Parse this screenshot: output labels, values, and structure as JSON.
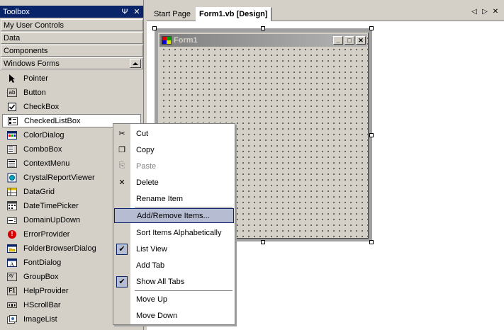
{
  "toolbox": {
    "title": "Toolbox",
    "pin_glyph": "Ψ",
    "close_glyph": "✕",
    "tabs": [
      "My User Controls",
      "Data",
      "Components",
      "Windows Forms"
    ],
    "items": [
      {
        "label": "Pointer",
        "icon": "pointer-icon"
      },
      {
        "label": "Button",
        "icon": "button-icon"
      },
      {
        "label": "CheckBox",
        "icon": "checkbox-icon"
      },
      {
        "label": "CheckedListBox",
        "icon": "checkedlistbox-icon"
      },
      {
        "label": "ColorDialog",
        "icon": "colordialog-icon"
      },
      {
        "label": "ComboBox",
        "icon": "combobox-icon"
      },
      {
        "label": "ContextMenu",
        "icon": "contextmenu-icon"
      },
      {
        "label": "CrystalReportViewer",
        "icon": "crystalreportviewer-icon"
      },
      {
        "label": "DataGrid",
        "icon": "datagrid-icon"
      },
      {
        "label": "DateTimePicker",
        "icon": "datetimepicker-icon"
      },
      {
        "label": "DomainUpDown",
        "icon": "domainupdown-icon"
      },
      {
        "label": "ErrorProvider",
        "icon": "errorprovider-icon"
      },
      {
        "label": "FolderBrowserDialog",
        "icon": "folderbrowserdialog-icon"
      },
      {
        "label": "FontDialog",
        "icon": "fontdialog-icon"
      },
      {
        "label": "GroupBox",
        "icon": "groupbox-icon"
      },
      {
        "label": "HelpProvider",
        "icon": "helpprovider-icon"
      },
      {
        "label": "HScrollBar",
        "icon": "hscrollbar-icon"
      },
      {
        "label": "ImageList",
        "icon": "imagelist-icon"
      }
    ],
    "icon_text": {
      "button": "ab",
      "helpprovider": "F1",
      "groupbox": "xy",
      "error": "!"
    }
  },
  "document": {
    "tabs": [
      "Start Page",
      "Form1.vb [Design]"
    ],
    "nav_left": "◁",
    "nav_right": "▷",
    "nav_close": "✕"
  },
  "form": {
    "title": "Form1",
    "min_glyph": "_",
    "max_glyph": "□",
    "close_glyph": "✕"
  },
  "context_menu": {
    "items": [
      {
        "label": "Cut",
        "icon": "cut-icon",
        "glyph": "✂",
        "disabled": false
      },
      {
        "label": "Copy",
        "icon": "copy-icon",
        "glyph": "❐",
        "disabled": false
      },
      {
        "label": "Paste",
        "icon": "paste-icon",
        "glyph": "⎘",
        "disabled": true
      },
      {
        "label": "Delete",
        "icon": "delete-icon",
        "glyph": "✕",
        "disabled": false
      },
      {
        "label": "Rename Item",
        "icon": "",
        "glyph": "",
        "disabled": false
      },
      {
        "label": "Add/Remove Items...",
        "icon": "",
        "glyph": "",
        "disabled": false,
        "highlighted": true
      },
      {
        "label": "Sort Items Alphabetically",
        "icon": "",
        "glyph": "",
        "disabled": false
      },
      {
        "label": "List View",
        "icon": "checkmark-icon",
        "glyph": "✔",
        "checked": true
      },
      {
        "label": "Add Tab",
        "icon": "",
        "glyph": "",
        "disabled": false
      },
      {
        "label": "Show All Tabs",
        "icon": "checkmark-icon",
        "glyph": "✔",
        "checked": true
      },
      {
        "label": "Move Up",
        "icon": "",
        "glyph": "",
        "disabled": false
      },
      {
        "label": "Move Down",
        "icon": "",
        "glyph": "",
        "disabled": false
      }
    ]
  },
  "colors": {
    "title_bar": "#0a246a",
    "face": "#d4d0c8",
    "menu_highlight": "#b6bdd2",
    "disabled_text": "#808080"
  }
}
